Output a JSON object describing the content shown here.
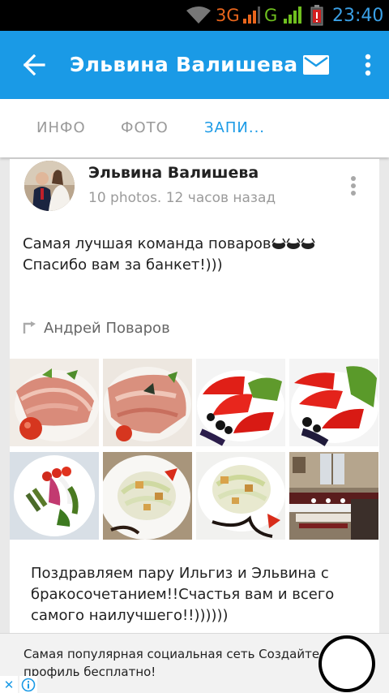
{
  "status_bar": {
    "network_3g": "3G",
    "network_g": "G",
    "time": "23:40",
    "icons": [
      "wifi-icon",
      "signal-icon",
      "signal-icon",
      "battery-low-icon"
    ]
  },
  "app_bar": {
    "title": "Эльвина Валишева",
    "icons": [
      "back-arrow-icon",
      "mail-icon",
      "more-vert-icon"
    ],
    "color": "#1a9ae6"
  },
  "tabs": [
    {
      "label": "ИНФО",
      "active": false
    },
    {
      "label": "ФОТО",
      "active": false
    },
    {
      "label": "ЗАПИ...",
      "active": true
    }
  ],
  "post": {
    "author": "Эльвина Валишева",
    "meta": "10 photos. 12 часов назад",
    "text_part1": "Самая лучшая команда поваров",
    "text_part2": "Спасибо вам за банкет!)))",
    "repost_author": "Андрей Поваров",
    "photos": [
      "meat-platter-1",
      "meat-platter-2",
      "tomatoes-1",
      "tomatoes-2",
      "salad-plate",
      "caesar-salad-1",
      "caesar-salad-2",
      "banquet-hall"
    ],
    "caption": "Поздравляем пару Ильгиз и Эльвина с бракосочетанием!!Счастья вам и всего самого наилучшего!!))))))"
  },
  "ad": {
    "line1": "Самая популярная социальная сеть Создайте",
    "line2": "профиль бесплатно!",
    "close_glyph": "✕"
  }
}
